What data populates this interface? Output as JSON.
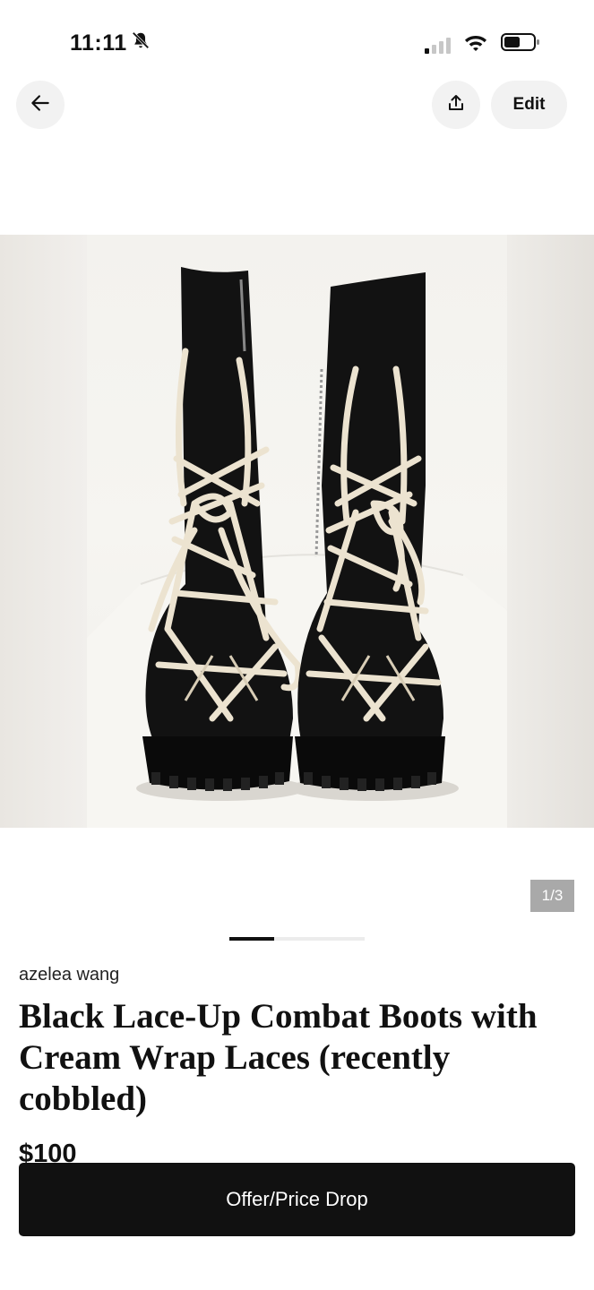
{
  "status_bar": {
    "time": "11:11",
    "icons": [
      "bell-slash-icon",
      "signal-icon",
      "wifi-icon",
      "battery-icon"
    ]
  },
  "nav": {
    "back_icon": "arrow-left-icon",
    "share_icon": "share-upload-icon",
    "edit_label": "Edit"
  },
  "gallery": {
    "counter": "1/3",
    "current_index": 1,
    "total": 3
  },
  "listing": {
    "seller": "azelea wang",
    "title": "Black Lace-Up Combat Boots with Cream Wrap Laces (recently cobbled)",
    "price": "$100"
  },
  "cta": {
    "label": "Offer/Price Drop"
  },
  "colors": {
    "primary_button": "#111111",
    "icon_button_bg": "#f2f2f2",
    "counter_badge": "#a9a9a9"
  }
}
